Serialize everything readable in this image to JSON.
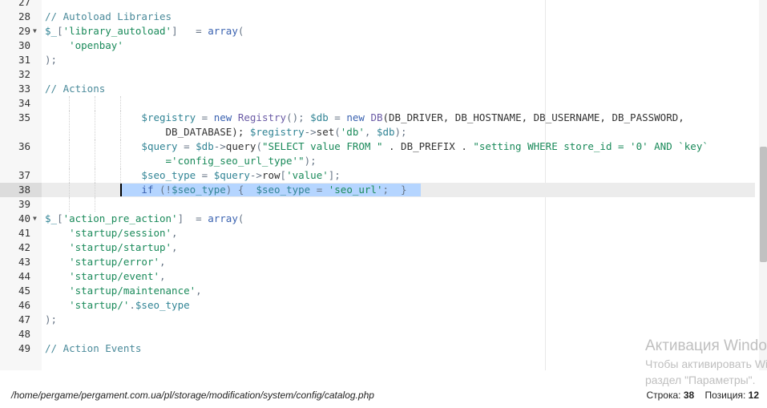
{
  "editor": {
    "lines": [
      {
        "n": "27",
        "tokens": []
      },
      {
        "n": "28",
        "tokens": [
          {
            "t": "// Autoload Libraries",
            "c": "c-cm"
          }
        ]
      },
      {
        "n": "29",
        "fold": true,
        "tokens": [
          {
            "t": "$_",
            "c": "c-var"
          },
          {
            "t": "[",
            "c": "c-op"
          },
          {
            "t": "'library_autoload'",
            "c": "c-str"
          },
          {
            "t": "]   = ",
            "c": "c-op"
          },
          {
            "t": "array",
            "c": "c-fn"
          },
          {
            "t": "(",
            "c": "c-op"
          }
        ]
      },
      {
        "n": "30",
        "tokens": [
          {
            "t": "    ",
            "c": ""
          },
          {
            "t": "'openbay'",
            "c": "c-str"
          }
        ]
      },
      {
        "n": "31",
        "tokens": [
          {
            "t": ");",
            "c": "c-op"
          }
        ]
      },
      {
        "n": "32",
        "tokens": []
      },
      {
        "n": "33",
        "tokens": [
          {
            "t": "// Actions",
            "c": "c-cm"
          }
        ]
      },
      {
        "n": "34",
        "tokens": [],
        "guides": [
          86,
          118,
          150
        ]
      },
      {
        "n": "35",
        "tall": true,
        "guides": [
          86,
          118,
          150
        ],
        "tokens": [
          {
            "t": "                ",
            "c": ""
          },
          {
            "t": "$registry",
            "c": "c-var"
          },
          {
            "t": " = ",
            "c": "c-op"
          },
          {
            "t": "new",
            "c": "c-kw"
          },
          {
            "t": " ",
            "c": ""
          },
          {
            "t": "Registry",
            "c": "c-cls"
          },
          {
            "t": "(); ",
            "c": "c-op"
          },
          {
            "t": "$db",
            "c": "c-var"
          },
          {
            "t": " = ",
            "c": "c-op"
          },
          {
            "t": "new",
            "c": "c-kw"
          },
          {
            "t": " ",
            "c": ""
          },
          {
            "t": "DB",
            "c": "c-cls"
          },
          {
            "t": "(DB_DRIVER, DB_HOSTNAME, DB_USERNAME, DB_PASSWORD,\n                    DB_DATABASE); ",
            "c": "c-id"
          },
          {
            "t": "$registry",
            "c": "c-var"
          },
          {
            "t": "->",
            "c": "c-op"
          },
          {
            "t": "set",
            "c": "c-id"
          },
          {
            "t": "(",
            "c": "c-op"
          },
          {
            "t": "'db'",
            "c": "c-str"
          },
          {
            "t": ", ",
            "c": "c-op"
          },
          {
            "t": "$db",
            "c": "c-var"
          },
          {
            "t": ");",
            "c": "c-op"
          }
        ]
      },
      {
        "n": "36",
        "tall": true,
        "guides": [
          86,
          118,
          150
        ],
        "tokens": [
          {
            "t": "                ",
            "c": ""
          },
          {
            "t": "$query",
            "c": "c-var"
          },
          {
            "t": " = ",
            "c": "c-op"
          },
          {
            "t": "$db",
            "c": "c-var"
          },
          {
            "t": "->",
            "c": "c-op"
          },
          {
            "t": "query",
            "c": "c-id"
          },
          {
            "t": "(",
            "c": "c-op"
          },
          {
            "t": "\"SELECT value FROM \"",
            "c": "c-str"
          },
          {
            "t": " . DB_PREFIX . ",
            "c": "c-id"
          },
          {
            "t": "\"setting WHERE store_id = '0' AND `key`\n                    ='config_seo_url_type'\"",
            "c": "c-str"
          },
          {
            "t": ");",
            "c": "c-op"
          }
        ]
      },
      {
        "n": "37",
        "guides": [
          86,
          118,
          150
        ],
        "tokens": [
          {
            "t": "                ",
            "c": ""
          },
          {
            "t": "$seo_type",
            "c": "c-var"
          },
          {
            "t": " = ",
            "c": "c-op"
          },
          {
            "t": "$query",
            "c": "c-var"
          },
          {
            "t": "->",
            "c": "c-op"
          },
          {
            "t": "row",
            "c": "c-id"
          },
          {
            "t": "[",
            "c": "c-op"
          },
          {
            "t": "'value'",
            "c": "c-str"
          },
          {
            "t": "];",
            "c": "c-op"
          }
        ]
      },
      {
        "n": "38",
        "active": true,
        "selected": true,
        "guides": [
          86,
          118
        ],
        "tokens": [
          {
            "t": "                ",
            "c": ""
          },
          {
            "t": "if",
            "c": "c-kw"
          },
          {
            "t": " (!",
            "c": "c-op"
          },
          {
            "t": "$seo_type",
            "c": "c-var"
          },
          {
            "t": ") {  ",
            "c": "c-op"
          },
          {
            "t": "$seo_type",
            "c": "c-var"
          },
          {
            "t": " = ",
            "c": "c-op"
          },
          {
            "t": "'seo_url'",
            "c": "c-str"
          },
          {
            "t": ";  }",
            "c": "c-op"
          }
        ]
      },
      {
        "n": "39",
        "guides": [
          86,
          118
        ],
        "tokens": []
      },
      {
        "n": "40",
        "fold": true,
        "tokens": [
          {
            "t": "$_",
            "c": "c-var"
          },
          {
            "t": "[",
            "c": "c-op"
          },
          {
            "t": "'action_pre_action'",
            "c": "c-str"
          },
          {
            "t": "]  = ",
            "c": "c-op"
          },
          {
            "t": "array",
            "c": "c-fn"
          },
          {
            "t": "(",
            "c": "c-op"
          }
        ]
      },
      {
        "n": "41",
        "tokens": [
          {
            "t": "    ",
            "c": ""
          },
          {
            "t": "'startup/session'",
            "c": "c-str"
          },
          {
            "t": ",",
            "c": "c-op"
          }
        ]
      },
      {
        "n": "42",
        "tokens": [
          {
            "t": "    ",
            "c": ""
          },
          {
            "t": "'startup/startup'",
            "c": "c-str"
          },
          {
            "t": ",",
            "c": "c-op"
          }
        ]
      },
      {
        "n": "43",
        "tokens": [
          {
            "t": "    ",
            "c": ""
          },
          {
            "t": "'startup/error'",
            "c": "c-str"
          },
          {
            "t": ",",
            "c": "c-op"
          }
        ]
      },
      {
        "n": "44",
        "tokens": [
          {
            "t": "    ",
            "c": ""
          },
          {
            "t": "'startup/event'",
            "c": "c-str"
          },
          {
            "t": ",",
            "c": "c-op"
          }
        ]
      },
      {
        "n": "45",
        "tokens": [
          {
            "t": "    ",
            "c": ""
          },
          {
            "t": "'startup/maintenance'",
            "c": "c-str"
          },
          {
            "t": ",",
            "c": "c-op"
          }
        ]
      },
      {
        "n": "46",
        "tokens": [
          {
            "t": "    ",
            "c": ""
          },
          {
            "t": "'startup/'",
            "c": "c-str"
          },
          {
            "t": ".",
            "c": "c-op"
          },
          {
            "t": "$seo_type",
            "c": "c-var"
          }
        ]
      },
      {
        "n": "47",
        "tokens": [
          {
            "t": ");",
            "c": "c-op"
          }
        ]
      },
      {
        "n": "48",
        "tokens": []
      },
      {
        "n": "49",
        "tokens": [
          {
            "t": "// Action Events",
            "c": "c-cm"
          }
        ]
      }
    ],
    "fold_icon": "fold-arrow-icon"
  },
  "statusbar": {
    "path": "/home/pergame/pergament.com.ua/pl/storage/modification/system/config/catalog.php",
    "row_label": "Строка:",
    "row_value": "38",
    "col_label": "Позиция:",
    "col_value": "12"
  },
  "watermark": {
    "line1": "Активация Windows",
    "line2": "Чтобы активировать Windows, перейдите в",
    "line3": "раздел \"Параметры\"."
  },
  "colors": {
    "active_line": "#ececec",
    "selection": "#b5d5ff",
    "string": "#1a8a5a",
    "keyword": "#3a62b0",
    "variable": "#318495",
    "comment": "#4a8a9a"
  }
}
